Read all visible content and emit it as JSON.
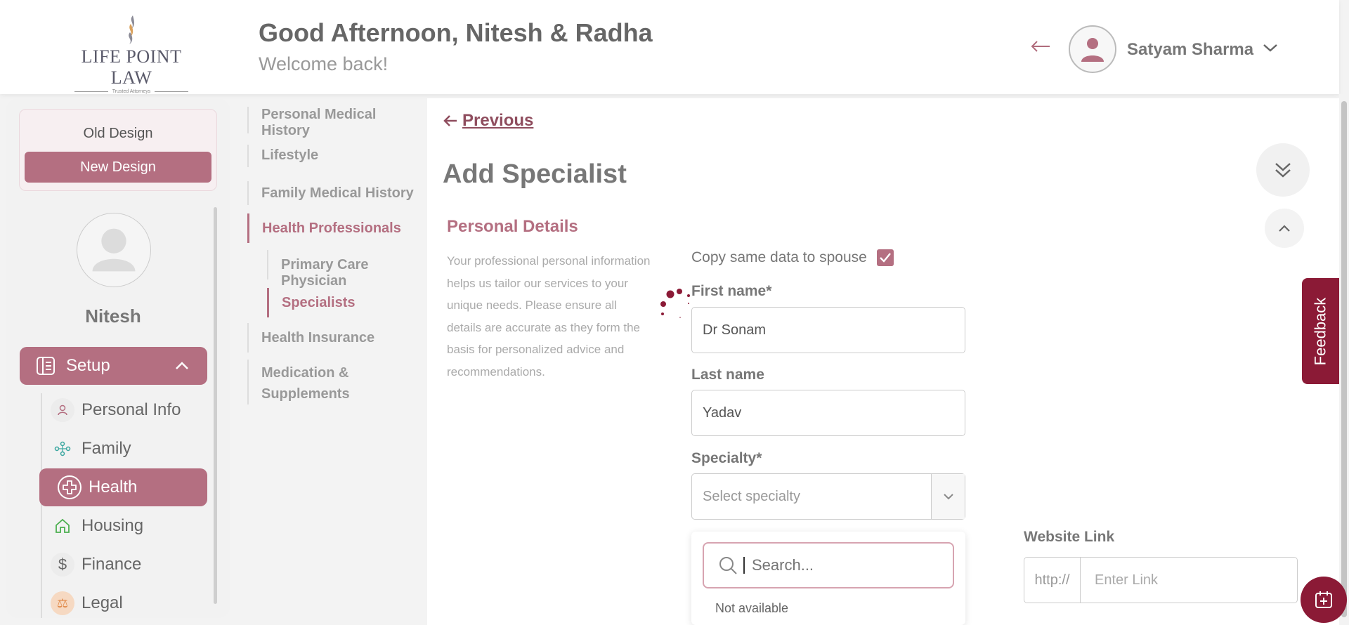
{
  "header": {
    "logo_text": "LIFE POINT LAW",
    "logo_tagline": "Trusted Attorneys",
    "greeting": "Good Afternoon, Nitesh & Radha",
    "welcome": "Welcome back!",
    "user_name": "Satyam Sharma"
  },
  "sidebar": {
    "old_design": "Old Design",
    "new_design": "New Design",
    "profile_name": "Nitesh",
    "setup_label": "Setup",
    "items": [
      {
        "label": "Personal Info",
        "icon": "person-icon"
      },
      {
        "label": "Family",
        "icon": "family-icon"
      },
      {
        "label": "Health",
        "icon": "health-plus-icon",
        "active": true
      },
      {
        "label": "Housing",
        "icon": "home-icon"
      },
      {
        "label": "Finance",
        "icon": "dollar-icon"
      },
      {
        "label": "Legal",
        "icon": "legal-icon"
      }
    ]
  },
  "subnav": {
    "items": [
      "Personal Medical History",
      "Lifestyle",
      "Family Medical History",
      "Health Professionals",
      "Primary Care Physician",
      "Specialists",
      "Health Insurance",
      "Medication &",
      "Supplements"
    ]
  },
  "main": {
    "previous": "Previous",
    "title": "Add Specialist",
    "section_title": "Personal Details",
    "section_desc": "Your professional personal information helps us tailor our services to your unique needs. Please ensure all details are accurate as they form the basis for personalized advice and recommendations.",
    "copy_label": "Copy same data to spouse",
    "copy_checked": true,
    "first_name_label": "First name*",
    "first_name_value": "Dr Sonam",
    "last_name_label": "Last name",
    "last_name_value": "Yadav",
    "specialty_label": "Specialty*",
    "specialty_placeholder": "Select specialty",
    "search_placeholder": "Search...",
    "option_not_available": "Not available",
    "website_label": "Website Link",
    "website_prefix": "http://",
    "website_placeholder": "Enter Link"
  },
  "feedback": "Feedback",
  "colors": {
    "accent": "#b46f81",
    "brand_dark": "#8b1a36"
  }
}
